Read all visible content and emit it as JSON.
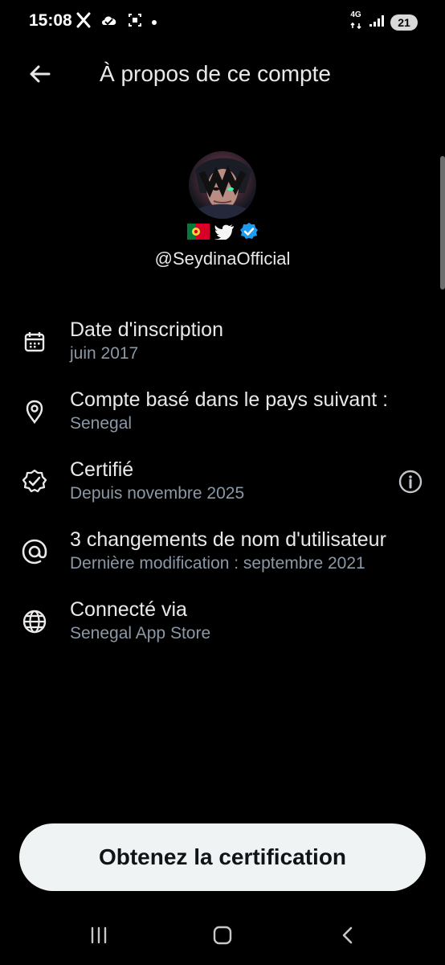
{
  "status_bar": {
    "time": "15:08",
    "network_top": "4G",
    "battery": "21",
    "icons": [
      "x-logo-icon",
      "cloud-icon",
      "screen-recorder-icon",
      "notification-dot-icon",
      "data-arrows-icon",
      "signal-icon"
    ]
  },
  "header": {
    "title": "À propos de ce compte",
    "back_icon": "arrow-left-icon"
  },
  "profile": {
    "handle": "@SeydinaOfficial",
    "badges": [
      "portugal-flag-icon",
      "twitter-bird-icon",
      "verified-badge-icon"
    ]
  },
  "details": [
    {
      "icon": "calendar-icon",
      "title": "Date d'inscription",
      "subtitle": "juin 2017"
    },
    {
      "icon": "location-pin-icon",
      "title": "Compte basé dans le pays suivant :",
      "subtitle": "Senegal"
    },
    {
      "icon": "verified-outline-icon",
      "title": "Certifié",
      "subtitle": "Depuis novembre 2025",
      "action_icon": "info-icon"
    },
    {
      "icon": "at-sign-icon",
      "title": "3 changements de nom d'utilisateur",
      "subtitle": "Dernière modification : septembre 2021"
    },
    {
      "icon": "globe-icon",
      "title": "Connecté via",
      "subtitle": "Senegal App Store"
    }
  ],
  "cta": {
    "label": "Obtenez la certification"
  },
  "navigation": {
    "icons": [
      "recent-apps-icon",
      "home-icon",
      "back-icon"
    ]
  },
  "colors": {
    "background": "#000000",
    "primary_text": "#e7e9ea",
    "secondary_text": "#8b98a5",
    "verified_blue": "#1d9bf0",
    "cta_background": "#eff3f4"
  }
}
